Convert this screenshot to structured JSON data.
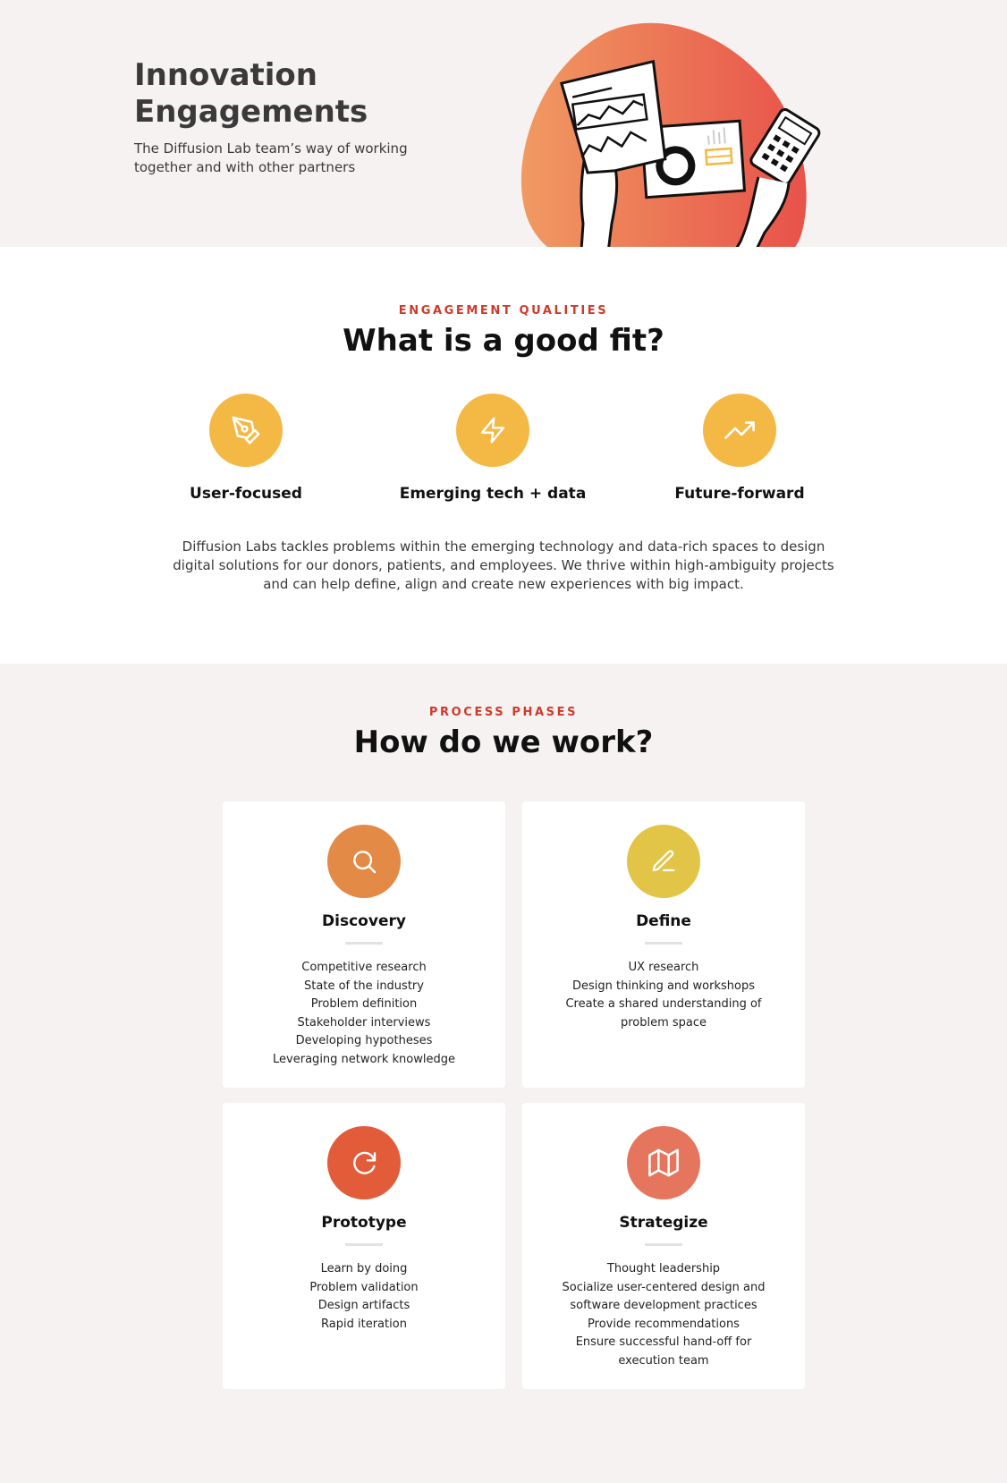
{
  "hero": {
    "title": "Innovation Engagements",
    "subtitle": "The Diffusion Lab team’s way of working together and with other partners",
    "illustration_icon": "hands-holding-reports-illustration",
    "blob_colors": [
      "#f09a62",
      "#e8524a"
    ]
  },
  "qualities": {
    "eyebrow": "ENGAGEMENT QUALITIES",
    "title": "What is a good fit?",
    "items": [
      {
        "label": "User-focused",
        "icon": "pen-tool-icon"
      },
      {
        "label": "Emerging tech + data",
        "icon": "lightning-icon"
      },
      {
        "label": "Future-forward",
        "icon": "trending-up-icon"
      }
    ],
    "description": "Diffusion Labs tackles problems within the emerging technology and data-rich spaces to design digital solutions for our donors, patients, and employees. We thrive within high-ambiguity projects and can help define, align and create new experiences with big impact.",
    "icon_color": "#f4b844"
  },
  "phases": {
    "eyebrow": "PROCESS PHASES",
    "title": "How do we work?",
    "cards": [
      {
        "title": "Discovery",
        "icon": "search-icon",
        "color": "#e38a46",
        "items": [
          "Competitive research",
          "State of the industry",
          "Problem definition",
          "Stakeholder interviews",
          "Developing hypotheses",
          "Leveraging network knowledge"
        ]
      },
      {
        "title": "Define",
        "icon": "pencil-icon",
        "color": "#e2c447",
        "items": [
          "UX research",
          "Design thinking and workshops",
          "Create a shared understanding of",
          "problem space"
        ]
      },
      {
        "title": "Prototype",
        "icon": "refresh-icon",
        "color": "#e35c3a",
        "items": [
          "Learn by doing",
          "Problem validation",
          "Design artifacts",
          "Rapid iteration"
        ]
      },
      {
        "title": "Strategize",
        "icon": "map-icon",
        "color": "#e5755c",
        "items": [
          "Thought leadership",
          "Socialize user-centered design and",
          "software development practices",
          "Provide recommendations",
          "Ensure successful hand-off for",
          "execution team"
        ]
      }
    ]
  }
}
